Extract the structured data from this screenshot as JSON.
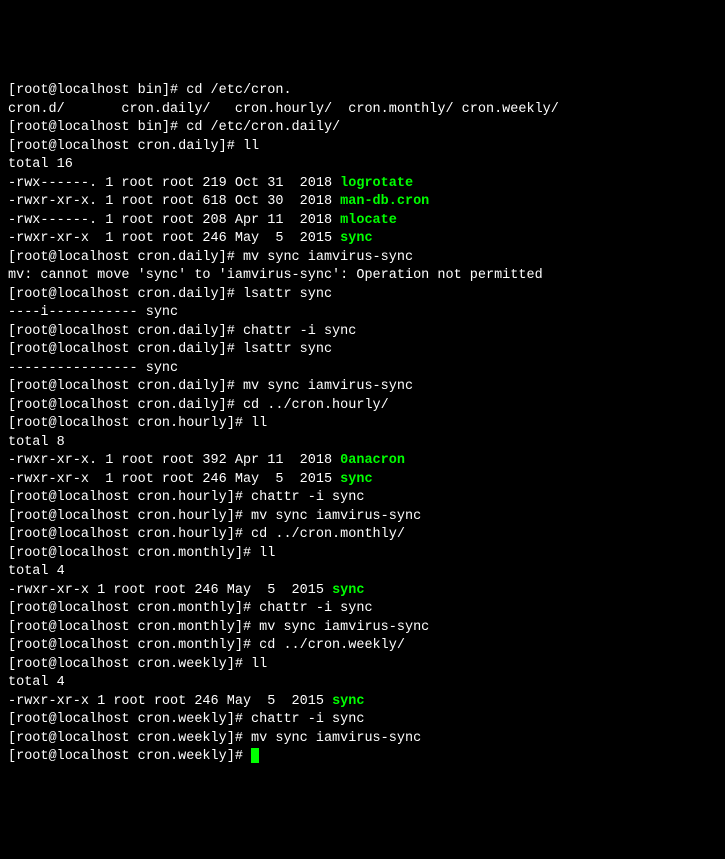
{
  "lines": [
    {
      "segs": [
        {
          "t": "[root@localhost bin]# cd /etc/cron."
        }
      ]
    },
    {
      "segs": [
        {
          "t": "cron.d/       cron.daily/   cron.hourly/  cron.monthly/ cron.weekly/"
        }
      ]
    },
    {
      "segs": [
        {
          "t": "[root@localhost bin]# cd /etc/cron.daily/"
        }
      ]
    },
    {
      "segs": [
        {
          "t": "[root@localhost cron.daily]# ll"
        }
      ]
    },
    {
      "segs": [
        {
          "t": "total 16"
        }
      ]
    },
    {
      "segs": [
        {
          "t": "-rwx------. 1 root root 219 Oct 31  2018 "
        },
        {
          "t": "logrotate",
          "c": "g"
        }
      ]
    },
    {
      "segs": [
        {
          "t": "-rwxr-xr-x. 1 root root 618 Oct 30  2018 "
        },
        {
          "t": "man-db.cron",
          "c": "g"
        }
      ]
    },
    {
      "segs": [
        {
          "t": "-rwx------. 1 root root 208 Apr 11  2018 "
        },
        {
          "t": "mlocate",
          "c": "g"
        }
      ]
    },
    {
      "segs": [
        {
          "t": "-rwxr-xr-x  1 root root 246 May  5  2015 "
        },
        {
          "t": "sync",
          "c": "g"
        }
      ]
    },
    {
      "segs": [
        {
          "t": "[root@localhost cron.daily]# mv sync iamvirus-sync"
        }
      ]
    },
    {
      "segs": [
        {
          "t": "mv: cannot move 'sync' to 'iamvirus-sync': Operation not permitted"
        }
      ]
    },
    {
      "segs": [
        {
          "t": "[root@localhost cron.daily]# lsattr sync"
        }
      ]
    },
    {
      "segs": [
        {
          "t": "----i----------- sync"
        }
      ]
    },
    {
      "segs": [
        {
          "t": "[root@localhost cron.daily]# chattr -i sync"
        }
      ]
    },
    {
      "segs": [
        {
          "t": "[root@localhost cron.daily]# lsattr sync"
        }
      ]
    },
    {
      "segs": [
        {
          "t": "---------------- sync"
        }
      ]
    },
    {
      "segs": [
        {
          "t": "[root@localhost cron.daily]# mv sync iamvirus-sync"
        }
      ]
    },
    {
      "segs": [
        {
          "t": "[root@localhost cron.daily]# cd ../cron.hourly/"
        }
      ]
    },
    {
      "segs": [
        {
          "t": "[root@localhost cron.hourly]# ll"
        }
      ]
    },
    {
      "segs": [
        {
          "t": "total 8"
        }
      ]
    },
    {
      "segs": [
        {
          "t": "-rwxr-xr-x. 1 root root 392 Apr 11  2018 "
        },
        {
          "t": "0anacron",
          "c": "g"
        }
      ]
    },
    {
      "segs": [
        {
          "t": "-rwxr-xr-x  1 root root 246 May  5  2015 "
        },
        {
          "t": "sync",
          "c": "g"
        }
      ]
    },
    {
      "segs": [
        {
          "t": "[root@localhost cron.hourly]# chattr -i sync"
        }
      ]
    },
    {
      "segs": [
        {
          "t": "[root@localhost cron.hourly]# mv sync iamvirus-sync"
        }
      ]
    },
    {
      "segs": [
        {
          "t": "[root@localhost cron.hourly]# cd ../cron.monthly/"
        }
      ]
    },
    {
      "segs": [
        {
          "t": "[root@localhost cron.monthly]# ll"
        }
      ]
    },
    {
      "segs": [
        {
          "t": "total 4"
        }
      ]
    },
    {
      "segs": [
        {
          "t": "-rwxr-xr-x 1 root root 246 May  5  2015 "
        },
        {
          "t": "sync",
          "c": "g"
        }
      ]
    },
    {
      "segs": [
        {
          "t": "[root@localhost cron.monthly]# chattr -i sync"
        }
      ]
    },
    {
      "segs": [
        {
          "t": "[root@localhost cron.monthly]# mv sync iamvirus-sync"
        }
      ]
    },
    {
      "segs": [
        {
          "t": "[root@localhost cron.monthly]# cd ../cron.weekly/"
        }
      ]
    },
    {
      "segs": [
        {
          "t": "[root@localhost cron.weekly]# ll"
        }
      ]
    },
    {
      "segs": [
        {
          "t": "total 4"
        }
      ]
    },
    {
      "segs": [
        {
          "t": "-rwxr-xr-x 1 root root 246 May  5  2015 "
        },
        {
          "t": "sync",
          "c": "g"
        }
      ]
    },
    {
      "segs": [
        {
          "t": "[root@localhost cron.weekly]# chattr -i sync"
        }
      ]
    },
    {
      "segs": [
        {
          "t": "[root@localhost cron.weekly]# mv sync iamvirus-sync"
        }
      ]
    },
    {
      "segs": [
        {
          "t": "[root@localhost cron.weekly]# "
        }
      ],
      "cursor": true
    }
  ]
}
